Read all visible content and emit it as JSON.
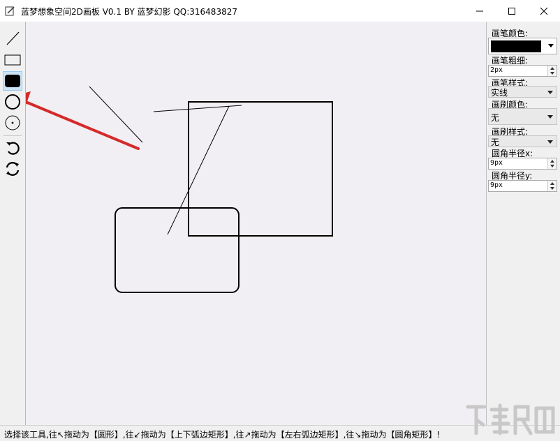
{
  "window": {
    "title": "蓝梦想象空间2D画板 V0.1 BY 蓝梦幻影 QQ:316483827"
  },
  "toolbox": {
    "tools": [
      {
        "name": "line-tool-icon"
      },
      {
        "name": "rectangle-tool-icon"
      },
      {
        "name": "filled-rectangle-tool-icon",
        "selected": true
      },
      {
        "name": "circle-tool-icon"
      },
      {
        "name": "dot-circle-tool-icon"
      },
      {
        "name": "undo-icon"
      },
      {
        "name": "refresh-icon"
      }
    ]
  },
  "panel": {
    "pen_color_label": "画笔颜色:",
    "pen_color_value": "#000000",
    "pen_width_label": "画笔粗细:",
    "pen_width_value": "2px",
    "pen_style_label": "画笔样式:",
    "pen_style_value": "实线",
    "brush_color_label": "画刷颜色:",
    "brush_color_value": "无",
    "brush_style_label": "画刷样式:",
    "brush_style_value": "无",
    "radius_x_label": "圆角半径x:",
    "radius_x_value": "9px",
    "radius_y_label": "圆角半径y:",
    "radius_y_value": "9px"
  },
  "status": {
    "text": "选择该工具,往↖拖动为【圆形】,往↙拖动为【上下弧边矩形】,往↗拖动为【左右弧边矩形】,往↘拖动为【圆角矩形】!"
  },
  "colors": {
    "canvas_bg": "#f1eff3",
    "annotation_arrow": "#d42a2a",
    "selected_tool": "#cce4f7"
  }
}
